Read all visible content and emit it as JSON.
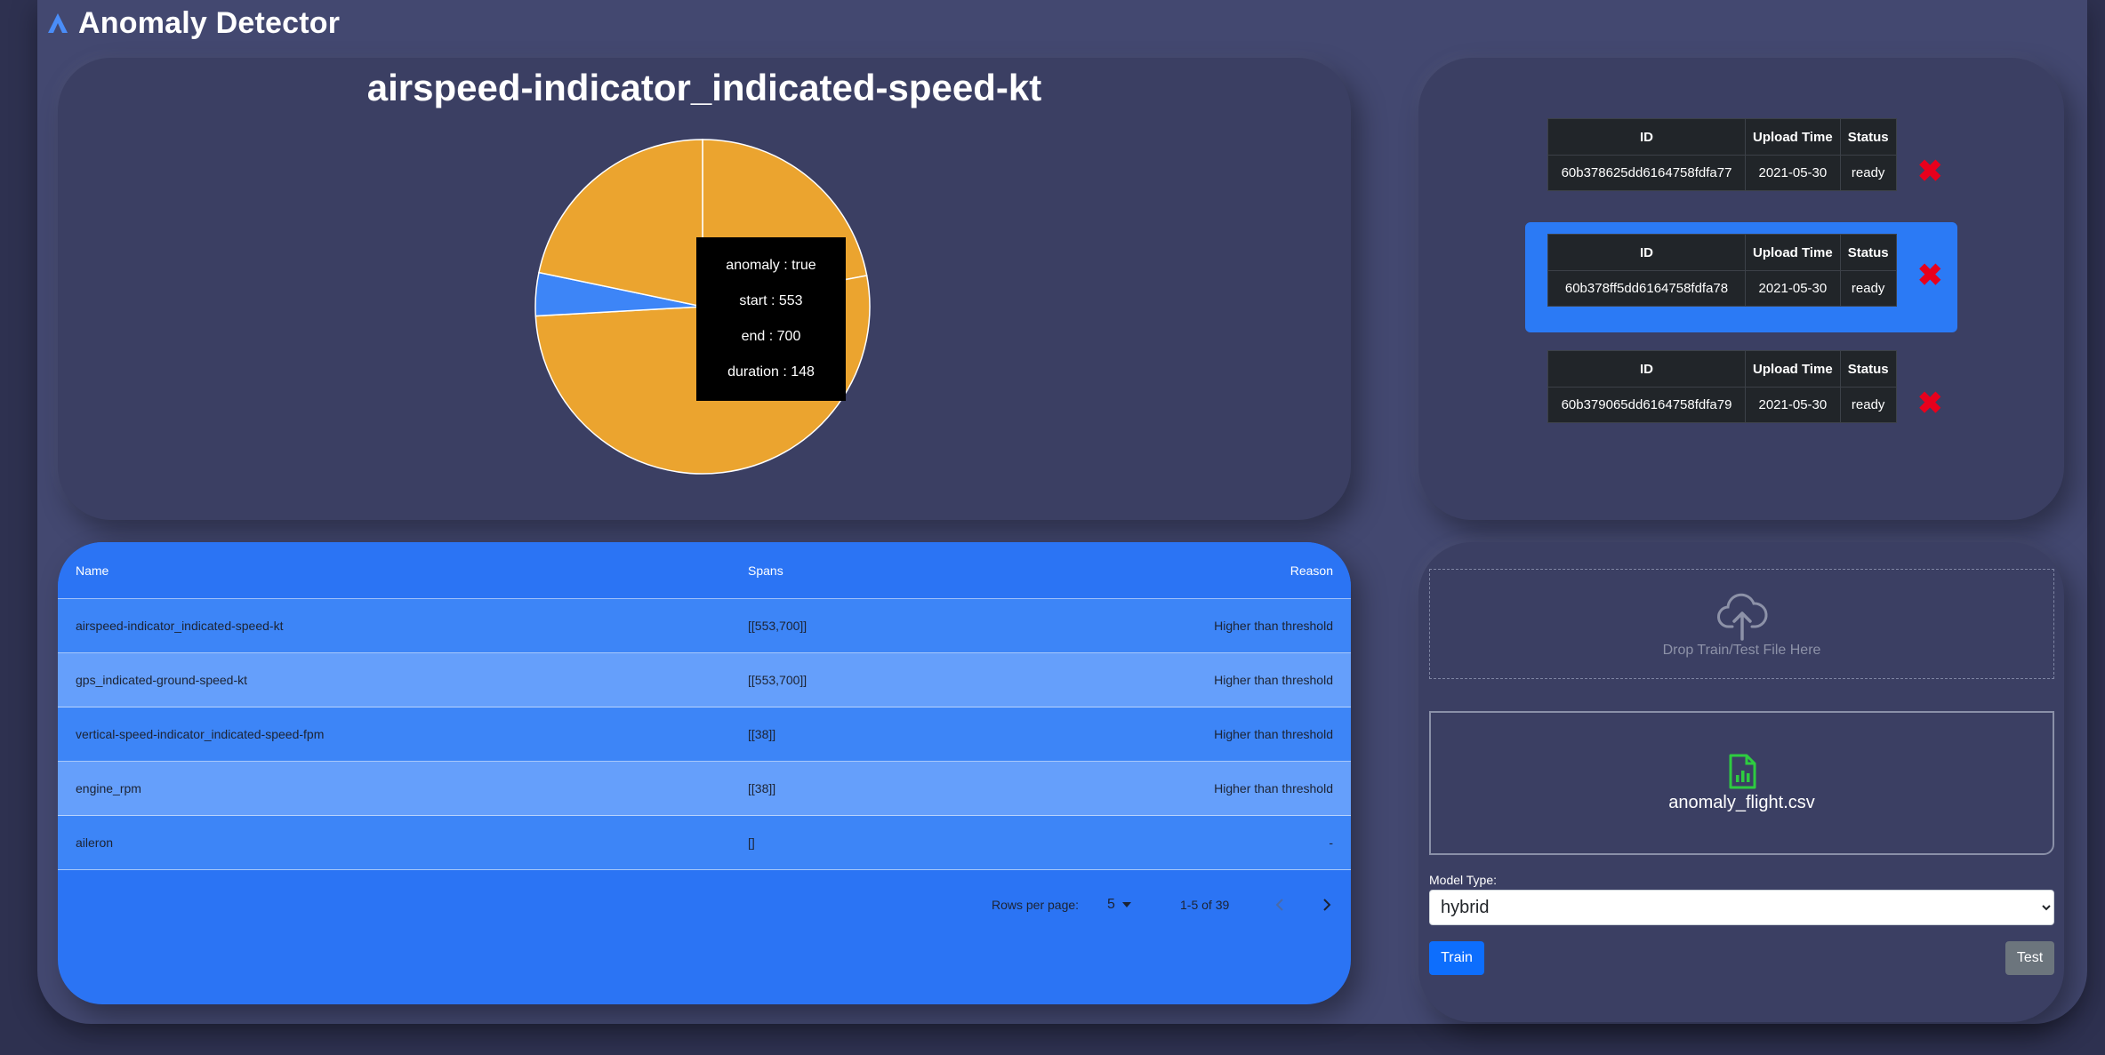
{
  "app": {
    "title": "Anomaly Detector"
  },
  "chart_data": {
    "type": "pie",
    "title": "airspeed-indicator_indicated-speed-kt",
    "slices": [
      {
        "label": "anomaly : true, start : 553, end : 700, duration : 148",
        "value": 148,
        "color": "#eba42f"
      },
      {
        "label": "",
        "value": 350,
        "color": "#eba42f"
      },
      {
        "label": "",
        "value": 28,
        "color": "#3d85f7"
      },
      {
        "label": "",
        "value": 146,
        "color": "#eba42f"
      }
    ],
    "tooltip": [
      "anomaly : true",
      "start : 553",
      "end : 700",
      "duration : 148"
    ],
    "colors": {
      "anomaly": "#eba42f",
      "normal": "#3d85f7"
    }
  },
  "models": {
    "headers": [
      "ID",
      "Upload Time",
      "Status"
    ],
    "rows": [
      {
        "id": "60b378625dd6164758fdfa77",
        "upload_time": "2021-05-30",
        "status": "ready"
      },
      {
        "id": "60b378ff5dd6164758fdfa78",
        "upload_time": "2021-05-30",
        "status": "ready"
      },
      {
        "id": "60b379065dd6164758fdfa79",
        "upload_time": "2021-05-30",
        "status": "ready"
      }
    ],
    "selected_index": 1,
    "delete_symbol": "✖"
  },
  "anomalies": {
    "headers": {
      "name": "Name",
      "spans": "Spans",
      "reason": "Reason"
    },
    "rows": [
      {
        "name": "airspeed-indicator_indicated-speed-kt",
        "spans": "[[553,700]]",
        "reason": "Higher than threshold"
      },
      {
        "name": "gps_indicated-ground-speed-kt",
        "spans": "[[553,700]]",
        "reason": "Higher than threshold"
      },
      {
        "name": "vertical-speed-indicator_indicated-speed-fpm",
        "spans": "[[38]]",
        "reason": "Higher than threshold"
      },
      {
        "name": "engine_rpm",
        "spans": "[[38]]",
        "reason": "Higher than threshold"
      },
      {
        "name": "aileron",
        "spans": "[]",
        "reason": "-"
      }
    ],
    "pagination": {
      "rows_label": "Rows per page:",
      "rows_value": "5",
      "range": "1-5 of 39"
    }
  },
  "upload": {
    "drop_label": "Drop Train/Test File Here",
    "file_name": "anomaly_flight.csv",
    "model_type_label": "Model Type:",
    "model_type_value": "hybrid",
    "model_type_options": [
      "hybrid"
    ],
    "train_label": "Train",
    "test_label": "Test"
  }
}
